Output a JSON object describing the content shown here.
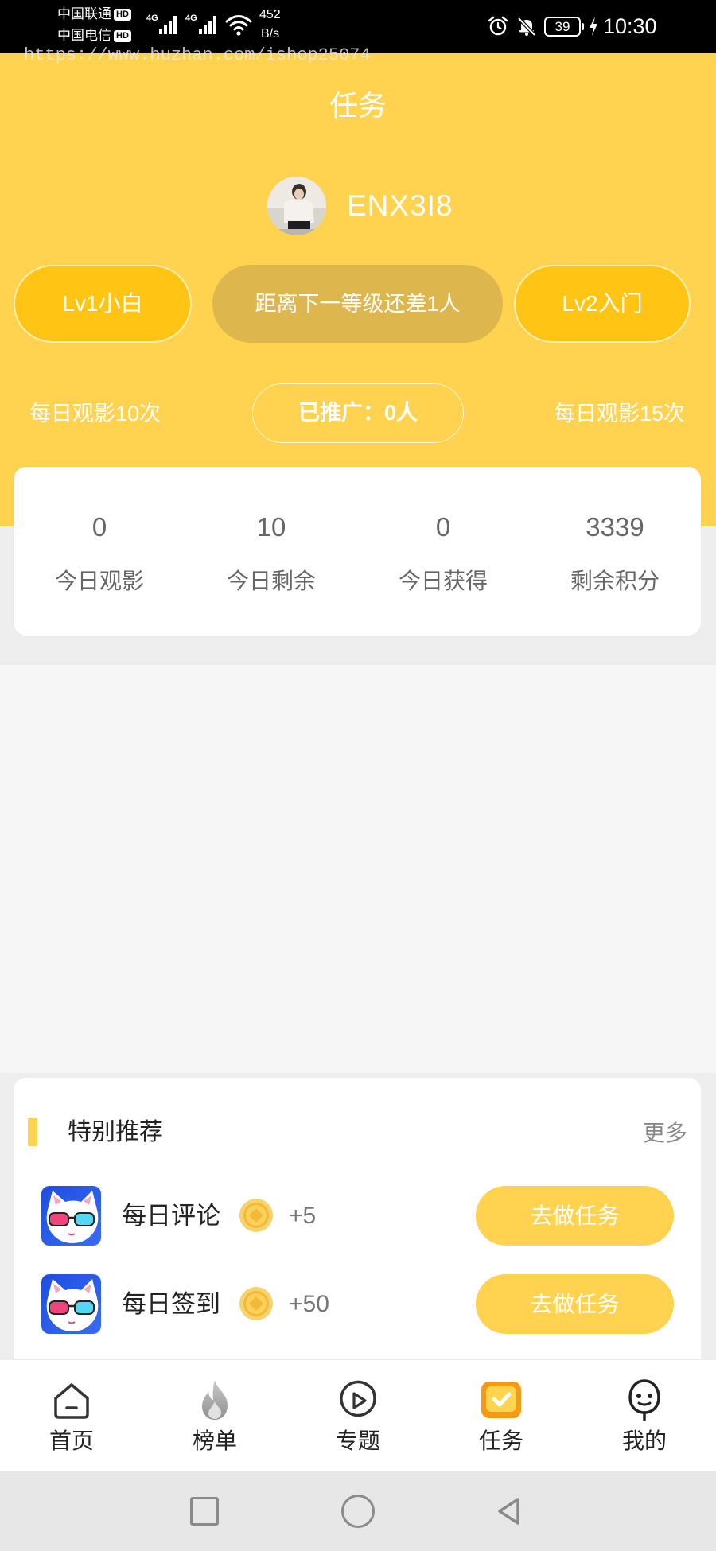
{
  "status_bar": {
    "carrier1": "中国联通",
    "carrier1_badge": "HD",
    "carrier2": "中国电信",
    "carrier2_badge": "HD",
    "network1": "4G",
    "network2": "4G",
    "speed_value": "452",
    "speed_unit": "B/s",
    "battery": "39",
    "time": "10:30",
    "icons": [
      "signal-icon",
      "wifi-icon",
      "alarm-icon",
      "bell-off-icon",
      "battery-icon",
      "charging-icon"
    ]
  },
  "watermark": "https://www.huzhan.com/ishop25074",
  "header": {
    "title": "任务"
  },
  "profile": {
    "username": "ENX3I8",
    "avatar_icon": "avatar-photo"
  },
  "level": {
    "current": "Lv1小白",
    "progress": "距离下一等级还差1人",
    "next": "Lv2入门"
  },
  "promo": {
    "current_benefit": "每日观影10次",
    "promoted": "已推广：0人",
    "next_benefit": "每日观影15次"
  },
  "stats": [
    {
      "value": "0",
      "label": "今日观影"
    },
    {
      "value": "10",
      "label": "今日剩余"
    },
    {
      "value": "0",
      "label": "今日获得"
    },
    {
      "value": "3339",
      "label": "剩余积分"
    }
  ],
  "recommend": {
    "title": "特别推荐",
    "more": "更多",
    "tasks": [
      {
        "icon": "cat-sunglasses-icon",
        "name": "每日评论",
        "reward_icon": "coin-icon",
        "reward": "+5",
        "button": "去做任务"
      },
      {
        "icon": "cat-sunglasses-icon",
        "name": "每日签到",
        "reward_icon": "coin-icon",
        "reward": "+50",
        "button": "去做任务"
      }
    ]
  },
  "bottom_nav": {
    "items": [
      {
        "label": "首页",
        "icon": "home-icon",
        "active": false
      },
      {
        "label": "榜单",
        "icon": "flame-icon",
        "active": false
      },
      {
        "label": "专题",
        "icon": "play-circle-icon",
        "active": false
      },
      {
        "label": "任务",
        "icon": "task-check-icon",
        "active": true
      },
      {
        "label": "我的",
        "icon": "face-icon",
        "active": false
      }
    ]
  },
  "system_nav": [
    "recent-apps-icon",
    "home-circle-icon",
    "back-triangle-icon"
  ],
  "theme": {
    "primary": "#FFD24F",
    "level_pill": "#FFC414",
    "progress_pill": "#DDB64E",
    "active_nav": "#F59A14"
  }
}
